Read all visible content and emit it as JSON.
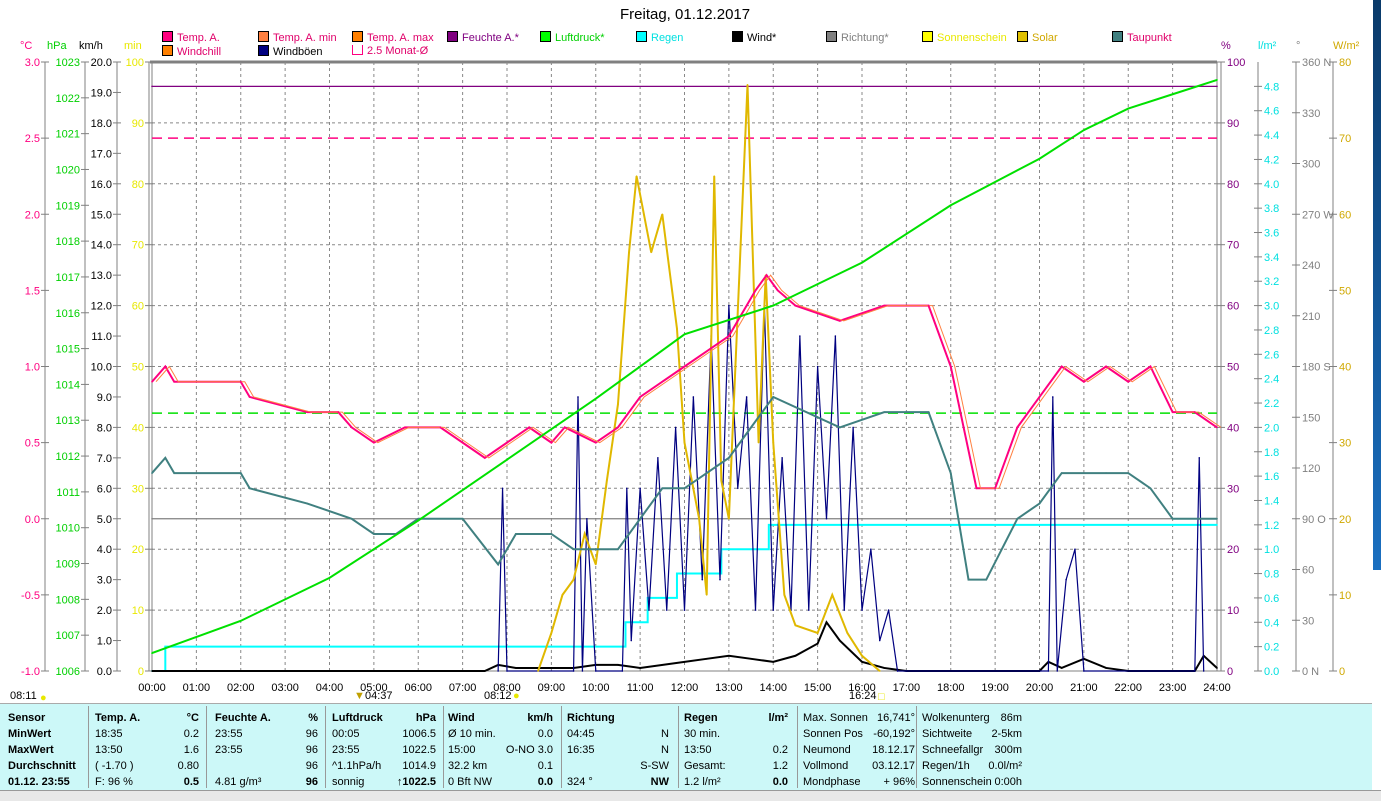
{
  "title": "Freitag, 01.12.2017",
  "legend": [
    {
      "label": "Temp. A.",
      "color": "#ff0080",
      "text": "#e0006a"
    },
    {
      "label": "Temp. A. min",
      "color": "#ff8040",
      "text": "#e0006a"
    },
    {
      "label": "Temp. A. max",
      "color": "#ff8000",
      "text": "#e0006a"
    },
    {
      "label": "Feuchte A.*",
      "color": "#800080",
      "text": "#800080"
    },
    {
      "label": "Luftdruck*",
      "color": "#00ff00",
      "text": "#00d000"
    },
    {
      "label": "Regen",
      "color": "#00ffff",
      "text": "#00e0e0"
    },
    {
      "label": "Wind*",
      "color": "#000000",
      "text": "#000"
    },
    {
      "label": "Richtung*",
      "color": "#808080",
      "text": "#808080"
    },
    {
      "label": "Sonnenschein",
      "color": "#ffff00",
      "text": "#e8e800"
    },
    {
      "label": "Solar",
      "color": "#e0c000",
      "text": "#d0a800"
    },
    {
      "label": "Taupunkt",
      "color": "#408080",
      "text": "#e0006a"
    },
    {
      "label": "Windchill",
      "color": "#ff8000",
      "text": "#e0006a"
    },
    {
      "label": "Windböen",
      "color": "#000080",
      "text": "#000"
    },
    {
      "label": "2.5 Monat-Ø",
      "color": "#ffffff",
      "text": "#e0006a"
    }
  ],
  "units": {
    "temp": "°C",
    "press": "hPa",
    "wind": "km/h",
    "sun": "min",
    "hum": "%",
    "rain": "l/m²",
    "dir": "°",
    "solar": "W/m²"
  },
  "chart_data": {
    "type": "line",
    "x_unit": "hour",
    "x_ticks": [
      "00:00",
      "01:00",
      "02:00",
      "03:00",
      "04:00",
      "05:00",
      "06:00",
      "07:00",
      "08:00",
      "09:00",
      "10:00",
      "11:00",
      "12:00",
      "13:00",
      "14:00",
      "15:00",
      "16:00",
      "17:00",
      "18:00",
      "19:00",
      "20:00",
      "21:00",
      "22:00",
      "23:00",
      "24:00"
    ],
    "axes": {
      "temp": {
        "range": [
          -1.0,
          3.0
        ],
        "ticks": [
          "3.0",
          "2.5",
          "2.0",
          "1.5",
          "1.0",
          "0.5",
          "0.0",
          "-0.5",
          "-1.0"
        ],
        "color": "#ff0080"
      },
      "press": {
        "range": [
          1006,
          1023
        ],
        "ticks": [
          "1023",
          "1022",
          "1021",
          "1020",
          "1019",
          "1018",
          "1017",
          "1016",
          "1015",
          "1014",
          "1013",
          "1012",
          "1011",
          "1010",
          "1009",
          "1008",
          "1007",
          "1006"
        ],
        "color": "#00d000"
      },
      "wind": {
        "range": [
          0,
          20
        ],
        "ticks": [
          "20.0",
          "19.0",
          "18.0",
          "17.0",
          "16.0",
          "15.0",
          "14.0",
          "13.0",
          "12.0",
          "11.0",
          "10.0",
          "9.0",
          "8.0",
          "7.0",
          "6.0",
          "5.0",
          "4.0",
          "3.0",
          "2.0",
          "1.0",
          "0.0"
        ],
        "color": "#000"
      },
      "sun": {
        "range": [
          0,
          100
        ],
        "ticks": [
          "100",
          "90",
          "80",
          "70",
          "60",
          "50",
          "40",
          "30",
          "20",
          "10",
          "0"
        ],
        "color": "#e8e800"
      },
      "hum": {
        "range": [
          0,
          100
        ],
        "ticks": [
          "100",
          "90",
          "80",
          "70",
          "60",
          "50",
          "40",
          "30",
          "20",
          "10",
          "0"
        ],
        "color": "#800080"
      },
      "rain": {
        "range": [
          0,
          5.0
        ],
        "ticks": [
          "4.8",
          "4.6",
          "4.4",
          "4.2",
          "4.0",
          "3.8",
          "3.6",
          "3.4",
          "3.2",
          "3.0",
          "2.8",
          "2.6",
          "2.4",
          "2.2",
          "2.0",
          "1.8",
          "1.6",
          "1.4",
          "1.2",
          "1.0",
          "0.8",
          "0.6",
          "0.4",
          "0.2",
          "0.0"
        ],
        "color": "#00e0e0"
      },
      "dir": {
        "range": [
          0,
          360
        ],
        "ticks": [
          "360 N",
          "330",
          "300",
          "270 W",
          "240",
          "210",
          "180 S",
          "150",
          "120",
          "90 O",
          "60",
          "30",
          "0 N"
        ],
        "color": "#808080"
      },
      "solar": {
        "range": [
          0,
          80
        ],
        "ticks": [
          "80",
          "70",
          "60",
          "50",
          "40",
          "30",
          "20",
          "10",
          "0"
        ],
        "color": "#d0a800"
      }
    },
    "series": [
      {
        "name": "Temp. A.",
        "axis": "temp",
        "color": "#ff0080",
        "x": [
          0,
          0.3,
          0.5,
          2,
          2.2,
          3.5,
          4.2,
          4.5,
          5,
          5.7,
          6.5,
          7,
          7.5,
          8,
          8.5,
          9,
          9.3,
          10,
          10.5,
          11,
          11.5,
          12,
          12.5,
          13,
          13.6,
          13.85,
          14.1,
          14.5,
          15.5,
          16.5,
          17.5,
          18,
          18.58,
          19,
          19.5,
          20,
          20.5,
          21,
          21.5,
          22,
          22.5,
          23,
          23.5,
          24
        ],
        "y": [
          0.9,
          1.0,
          0.9,
          0.9,
          0.8,
          0.7,
          0.7,
          0.6,
          0.5,
          0.6,
          0.6,
          0.5,
          0.4,
          0.5,
          0.6,
          0.5,
          0.6,
          0.5,
          0.6,
          0.8,
          0.9,
          1.0,
          1.1,
          1.2,
          1.5,
          1.6,
          1.5,
          1.4,
          1.3,
          1.4,
          1.4,
          1.0,
          0.2,
          0.2,
          0.6,
          0.8,
          1.0,
          0.9,
          1.0,
          0.9,
          1.0,
          0.7,
          0.7,
          0.6
        ]
      },
      {
        "name": "Taupunkt",
        "axis": "temp",
        "color": "#408080",
        "x": [
          0,
          0.3,
          0.5,
          2,
          2.2,
          3.5,
          4.5,
          5,
          5.5,
          6,
          7,
          7.8,
          8.2,
          9,
          9.5,
          10.5,
          11,
          11.5,
          12,
          13,
          13.5,
          14,
          15.5,
          16.5,
          17.5,
          18,
          18.4,
          18.8,
          19.5,
          20,
          20.5,
          21.5,
          22,
          22.5,
          23,
          24
        ],
        "y": [
          0.3,
          0.4,
          0.3,
          0.3,
          0.2,
          0.1,
          0.0,
          -0.1,
          -0.1,
          0.0,
          0.0,
          -0.3,
          -0.1,
          -0.1,
          -0.2,
          -0.2,
          0.0,
          0.2,
          0.2,
          0.4,
          0.6,
          0.8,
          0.6,
          0.7,
          0.7,
          0.3,
          -0.4,
          -0.4,
          0.0,
          0.1,
          0.3,
          0.3,
          0.3,
          0.2,
          0.0,
          0.0
        ]
      },
      {
        "name": "Luftdruck",
        "axis": "press",
        "color": "#00e000",
        "x": [
          0,
          2,
          4,
          6,
          8,
          10,
          12,
          14,
          16,
          18,
          20,
          21,
          22,
          23,
          24
        ],
        "y": [
          1006.5,
          1007.4,
          1008.6,
          1010.2,
          1011.9,
          1013.6,
          1015.4,
          1016.2,
          1017.4,
          1019.0,
          1020.3,
          1021.1,
          1021.7,
          1022.1,
          1022.5
        ]
      },
      {
        "name": "Feuchte A.",
        "axis": "hum",
        "color": "#800080",
        "x": [
          0,
          24
        ],
        "y": [
          96,
          96
        ]
      },
      {
        "name": "Solar",
        "axis": "solar",
        "color": "#e0b800",
        "x": [
          8.7,
          9,
          9.25,
          9.5,
          9.75,
          10,
          10.25,
          10.5,
          10.75,
          10.92,
          11.25,
          11.5,
          11.83,
          12,
          12.33,
          12.5,
          12.67,
          12.83,
          13,
          13.42,
          13.67,
          13.83,
          14,
          14.25,
          14.5,
          15,
          15.33,
          15.67,
          16,
          16.4
        ],
        "y": [
          0,
          5,
          10,
          12,
          18,
          14,
          25,
          35,
          55,
          65,
          55,
          60,
          45,
          30,
          20,
          10,
          65,
          25,
          20,
          77,
          30,
          52,
          30,
          10,
          6,
          5,
          10,
          5,
          2,
          0
        ]
      },
      {
        "name": "Windböen",
        "axis": "wind",
        "color": "#000080",
        "x": [
          7.8,
          7.9,
          8,
          9.5,
          9.6,
          9.7,
          9.8,
          10,
          10.6,
          10.7,
          10.8,
          11,
          11.2,
          11.4,
          11.6,
          11.8,
          12,
          12.2,
          12.4,
          12.6,
          12.8,
          13,
          13.2,
          13.4,
          13.6,
          13.8,
          14,
          14.2,
          14.4,
          14.6,
          14.8,
          15,
          15.2,
          15.4,
          15.6,
          15.8,
          16,
          16.2,
          16.4,
          16.6,
          16.8,
          17,
          20.2,
          20.3,
          20.4,
          20.6,
          20.8,
          21,
          23.5,
          23.6,
          23.7
        ],
        "y": [
          0,
          6,
          0,
          0,
          9,
          0,
          5,
          0,
          0,
          6,
          1,
          6,
          2,
          7,
          2,
          8,
          2,
          9,
          3,
          11,
          3,
          12,
          6,
          9,
          2,
          12,
          2,
          7,
          2,
          11,
          2,
          10,
          5,
          11,
          2,
          8,
          2,
          4,
          1,
          2,
          0,
          0,
          0,
          9,
          0,
          3,
          4,
          0,
          0,
          7,
          0
        ]
      },
      {
        "name": "Wind",
        "axis": "wind",
        "color": "#000000",
        "x": [
          0,
          7.5,
          7.8,
          8.2,
          9.5,
          10,
          10.5,
          11,
          12,
          12.5,
          13,
          13.5,
          14,
          14.5,
          15,
          15.2,
          15.5,
          16,
          16.5,
          17,
          20,
          20.2,
          20.5,
          21,
          21.5,
          22,
          23.5,
          23.7,
          24
        ],
        "y": [
          0,
          0,
          0.2,
          0.1,
          0.1,
          0.2,
          0.2,
          0.1,
          0.3,
          0.4,
          0.5,
          0.4,
          0.3,
          0.5,
          0.9,
          1.6,
          1.0,
          0.3,
          0.1,
          0,
          0,
          0.3,
          0.1,
          0.4,
          0.1,
          0,
          0,
          0.5,
          0.1
        ]
      },
      {
        "name": "Regen",
        "axis": "rain",
        "color": "#00ffff",
        "step": true,
        "x": [
          0,
          0.3,
          10.67,
          11.17,
          11.83,
          12.83,
          13.9,
          24
        ],
        "y": [
          0,
          0.2,
          0.4,
          0.6,
          0.8,
          1.0,
          1.2,
          1.2
        ]
      },
      {
        "name": "Richtung",
        "axis": "dir",
        "color": "#808080",
        "x": [
          0,
          24
        ],
        "y": [
          90,
          90
        ]
      }
    ],
    "reference_lines": [
      {
        "name": "2.5 Monat-Ø",
        "axis": "temp",
        "value": 2.5,
        "color": "#ff0080",
        "dashed": true
      },
      {
        "name": "Luftdruck-Ø",
        "axis": "press",
        "value": 1013.2,
        "color": "#00e000",
        "dashed": true
      }
    ]
  },
  "markers": {
    "sunrise": "08:11",
    "moonset": "04:37",
    "sunrise2": "08:12",
    "sunset": "16:24"
  },
  "panel": {
    "sensor": {
      "h": "Sensor",
      "rows": [
        "MinWert",
        "MaxWert",
        "Durchschnitt",
        "01.12. 23:55"
      ]
    },
    "temp": {
      "h": "Temp. A.",
      "u": "°C",
      "rows": [
        [
          "18:35",
          "0.2"
        ],
        [
          "13:50",
          "1.6"
        ],
        [
          "( -1.70 )",
          "0.80"
        ],
        [
          "F: 96 %",
          "0.5"
        ]
      ]
    },
    "hum": {
      "h": "Feuchte A.",
      "u": "%",
      "rows": [
        [
          "23:55",
          "96"
        ],
        [
          "23:55",
          "96"
        ],
        [
          "",
          "96"
        ],
        [
          "4.81 g/m³",
          "96"
        ]
      ]
    },
    "press": {
      "h": "Luftdruck",
      "u": "hPa",
      "rows": [
        [
          "00:05",
          "1006.5"
        ],
        [
          "23:55",
          "1022.5"
        ],
        [
          "^1.1hPa/h",
          "1014.9"
        ],
        [
          "sonnig",
          "↑1022.5"
        ]
      ]
    },
    "wind": {
      "h": "Wind",
      "u": "km/h",
      "rows": [
        [
          "Ø 10 min.",
          "0.0"
        ],
        [
          "15:00",
          "O-NO 3.0"
        ],
        [
          "32.2 km",
          "0.1"
        ],
        [
          "0 Bft NW",
          "0.0"
        ]
      ]
    },
    "dir": {
      "h": "Richtung",
      "u": "",
      "rows": [
        [
          "04:45",
          "N"
        ],
        [
          "16:35",
          "N"
        ],
        [
          "",
          "S-SW"
        ],
        [
          "324 °",
          "NW"
        ]
      ]
    },
    "rain": {
      "h": "Regen",
      "u": "l/m²",
      "rows": [
        [
          "30 min.",
          ""
        ],
        [
          "13:50",
          "0.2"
        ],
        [
          "Gesamt:",
          "1.2"
        ],
        [
          "1.2 l/m²",
          "0.0"
        ]
      ]
    },
    "sun": {
      "rows": [
        [
          "Max. Sonnen",
          "16,741°"
        ],
        [
          "Sonnen Pos",
          "-60,192°"
        ],
        [
          "Neumond",
          "18.12.17"
        ],
        [
          "Vollmond",
          "03.12.17"
        ],
        [
          "Mondphase",
          "+ 96%"
        ]
      ]
    },
    "misc": {
      "rows": [
        [
          "Wolkenunterg",
          "86m"
        ],
        [
          "Sichtweite",
          "2-5km"
        ],
        [
          "Schneefallgr",
          "300m"
        ],
        [
          "Regen/1h",
          "0.0l/m²"
        ],
        [
          "Sonnenschein",
          "0:00h"
        ]
      ]
    }
  }
}
